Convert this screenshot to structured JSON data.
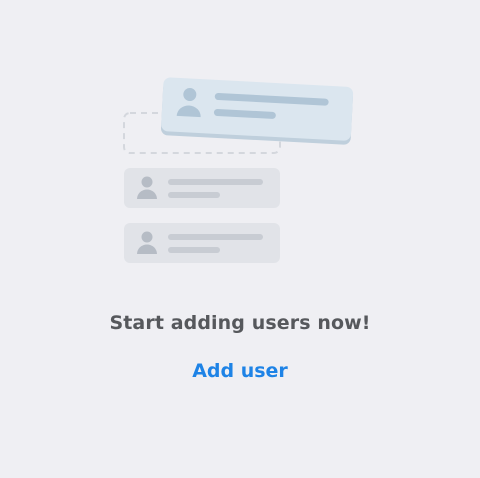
{
  "empty_state": {
    "message": "Start adding users now!",
    "add_user_label": "Add user"
  },
  "colors": {
    "background": "#efeff3",
    "placeholder_card": "#e1e3e8",
    "placeholder_icon": "#b6bcc5",
    "placeholder_line": "#c8ccd3",
    "dragged_card": "#dbe6ef",
    "dragged_card_shadow": "#bfcfdc",
    "dragged_icon": "#b0c5d6",
    "dashed_slot": "#d4d7dd",
    "message_text": "#56585c",
    "link_text": "#1e83e6"
  },
  "icons": [
    "user-icon"
  ]
}
